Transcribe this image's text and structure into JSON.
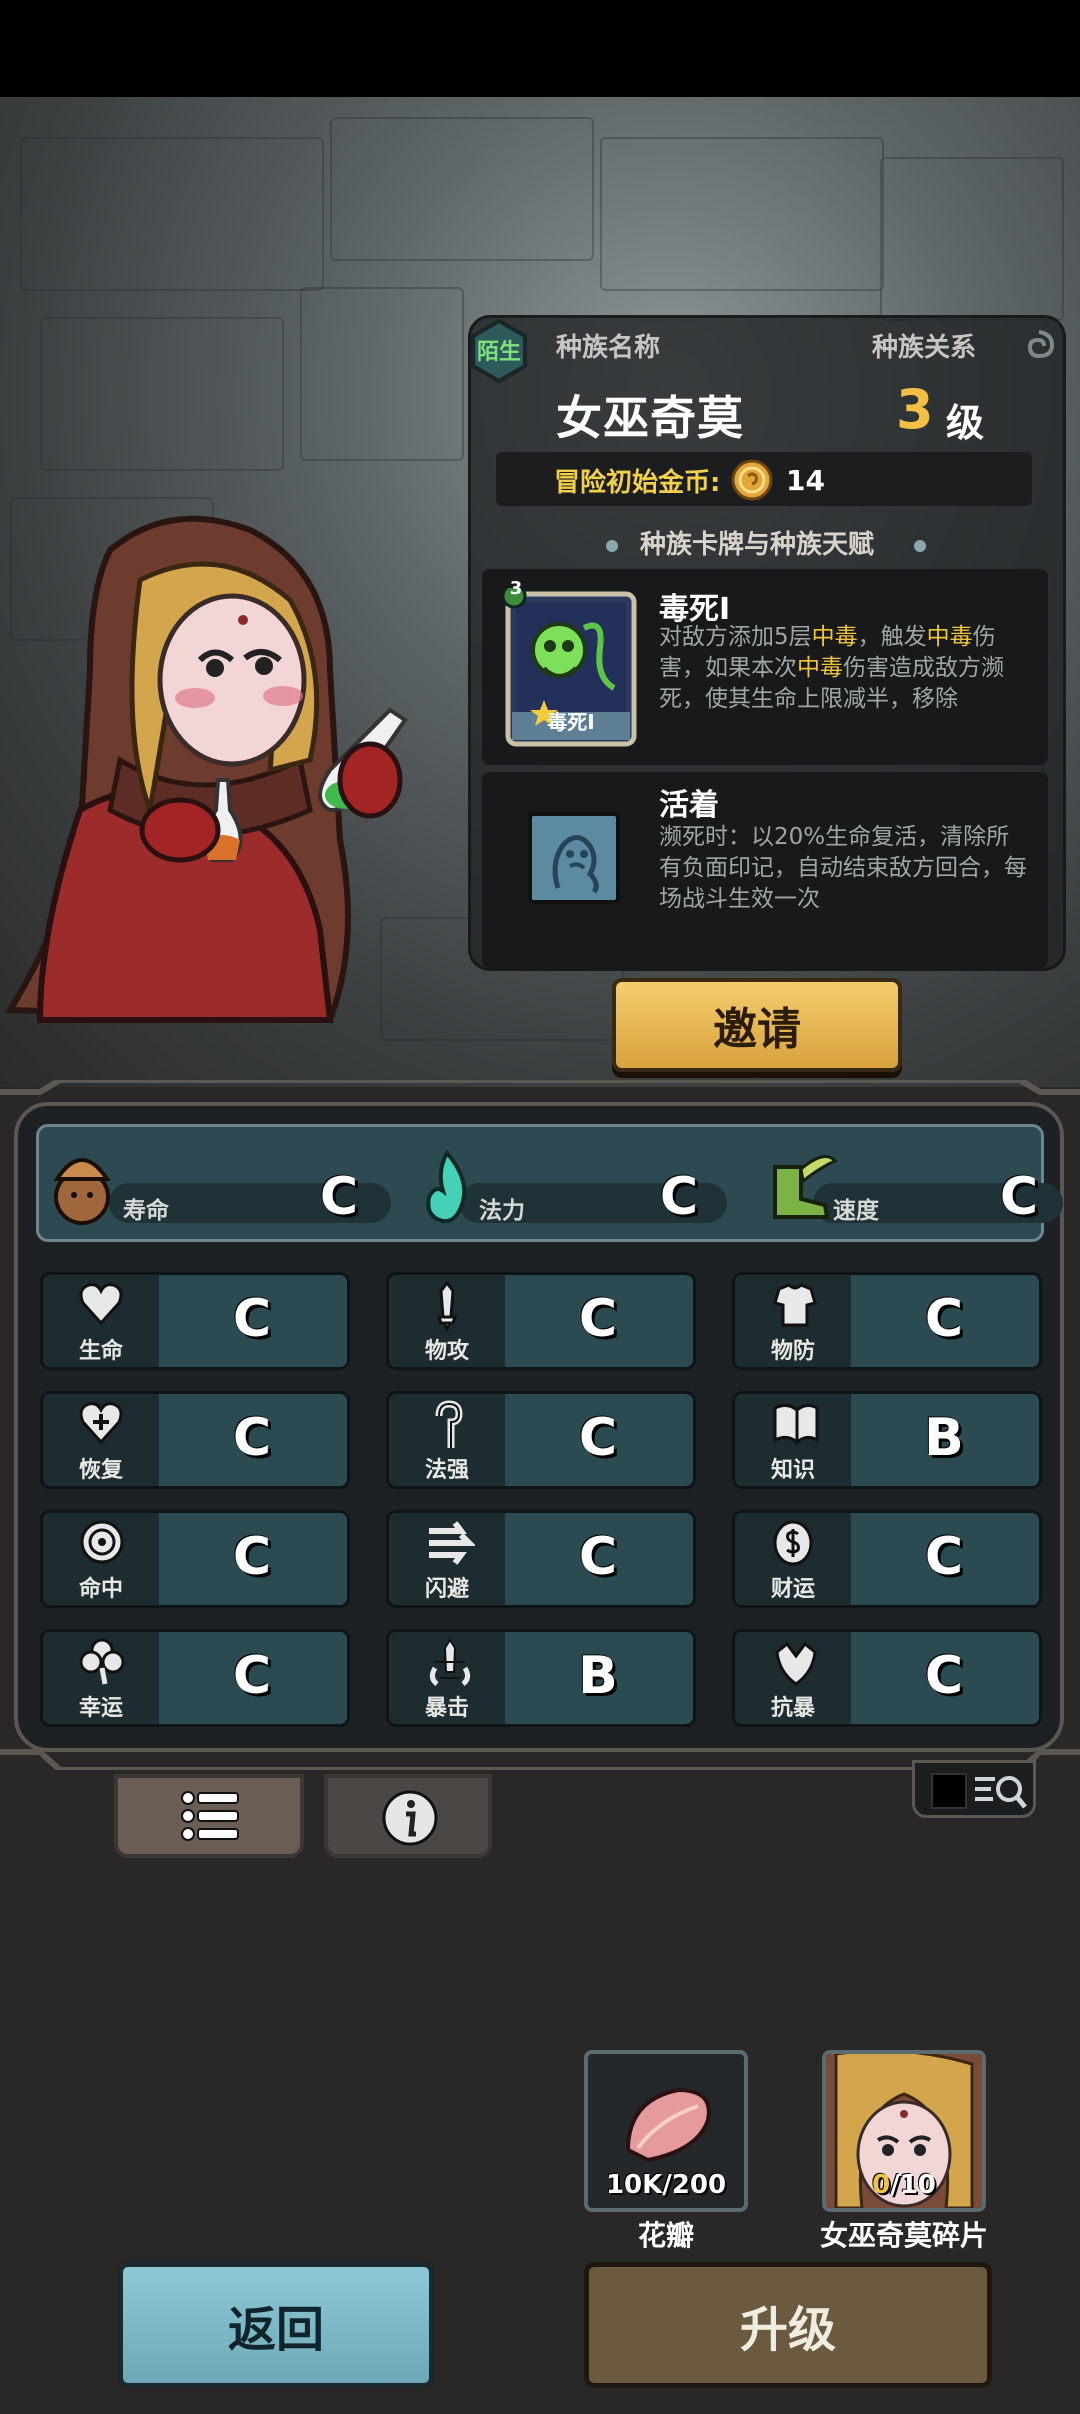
{
  "race": {
    "relation_badge": "陌生",
    "name_label": "种族名称",
    "relation_label": "种族关系",
    "name": "女巫奇莫",
    "level": "3",
    "level_unit": "级",
    "start_coin_label": "冒险初始金币:",
    "start_coin_value": "14",
    "section_title": "种族卡牌与种族天赋"
  },
  "cards": [
    {
      "badge": "3",
      "card_caption": "毒死Ⅰ",
      "title": "毒死Ⅰ",
      "desc_a": "对敌方添加5层",
      "desc_b": "中毒",
      "desc_c": "，触发",
      "desc_d": "中毒",
      "desc_e": "伤害，如果本次",
      "desc_f": "中毒",
      "desc_g": "伤害造成敌方濒死，使其生命上限减半，移除"
    },
    {
      "title": "活着",
      "desc": "濒死时：以20%生命复活，清除所有负面印记，自动结束敌方回合，每场战斗生效一次"
    }
  ],
  "buttons": {
    "invite": "邀请",
    "back": "返回",
    "upgrade": "升级"
  },
  "top_stats": [
    {
      "label": "寿命",
      "grade": "C",
      "icon": "lifespan-icon"
    },
    {
      "label": "法力",
      "grade": "C",
      "icon": "mana-flame-icon"
    },
    {
      "label": "速度",
      "grade": "C",
      "icon": "winged-boot-icon"
    }
  ],
  "stats": [
    {
      "label": "生命",
      "grade": "C",
      "icon": "heart-icon"
    },
    {
      "label": "物攻",
      "grade": "C",
      "icon": "sword-icon"
    },
    {
      "label": "物防",
      "grade": "C",
      "icon": "armor-icon"
    },
    {
      "label": "恢复",
      "grade": "C",
      "icon": "heal-heart-icon"
    },
    {
      "label": "法强",
      "grade": "C",
      "icon": "staff-icon"
    },
    {
      "label": "知识",
      "grade": "B",
      "icon": "book-icon"
    },
    {
      "label": "命中",
      "grade": "C",
      "icon": "target-icon"
    },
    {
      "label": "闪避",
      "grade": "C",
      "icon": "dodge-arrows-icon"
    },
    {
      "label": "财运",
      "grade": "C",
      "icon": "coin-icon"
    },
    {
      "label": "幸运",
      "grade": "C",
      "icon": "clover-icon"
    },
    {
      "label": "暴击",
      "grade": "B",
      "icon": "critical-sword-icon"
    },
    {
      "label": "抗暴",
      "grade": "C",
      "icon": "shield-burst-icon"
    }
  ],
  "resources": [
    {
      "name": "花瓣",
      "count": "10K/200",
      "icon": "petal-icon"
    },
    {
      "name": "女巫奇莫碎片",
      "count_have": "0",
      "count_need": "/10",
      "icon": "witch-portrait-icon"
    }
  ],
  "colors": {
    "accent_yellow": "#f0c53e",
    "panel_teal": "#2b4a52",
    "button_blue": "#8cc8d6",
    "button_brown": "#6b5a40",
    "invite_gold": "#e4b252",
    "stranger_green": "#7de27a"
  }
}
